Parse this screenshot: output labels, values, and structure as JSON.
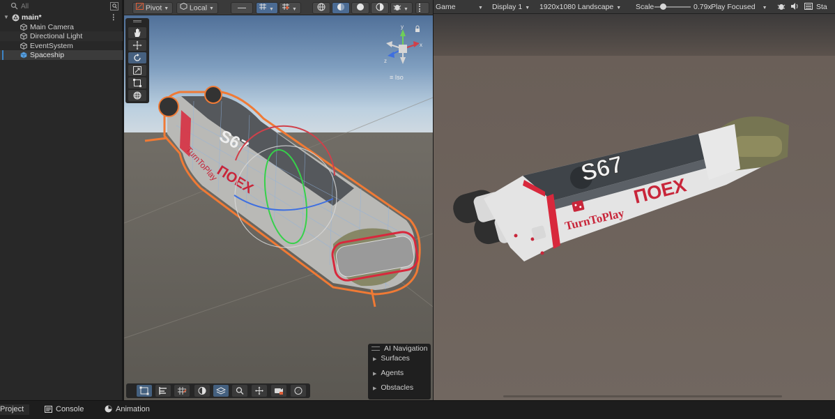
{
  "hierarchy": {
    "search_placeholder": "All",
    "scene_name": "main*",
    "items": [
      {
        "label": "Main Camera"
      },
      {
        "label": "Directional Light"
      },
      {
        "label": "EventSystem"
      },
      {
        "label": "Spaceship"
      }
    ]
  },
  "scene_toolbar": {
    "pivot_label": "Pivot",
    "space_label": "Local"
  },
  "scene": {
    "projection_label": "Iso",
    "gizmo_axes": {
      "y": "y",
      "x": "x",
      "z": "z"
    },
    "ship_number": "S67",
    "ship_brand": "TurnToPlay",
    "ship_text": "ПОЕХ"
  },
  "ai_navigation": {
    "title": "AI Navigation",
    "items": [
      {
        "label": "Surfaces"
      },
      {
        "label": "Agents"
      },
      {
        "label": "Obstacles"
      }
    ]
  },
  "game_toolbar": {
    "tab_label": "Game",
    "display_label": "Display 1",
    "resolution_label": "1920x1080 Landscape",
    "scale_label": "Scale",
    "scale_value": "0.79x",
    "play_mode_label": "Play Focused",
    "stats_label": "Sta"
  },
  "bottom_tabs": [
    {
      "label": "Project"
    },
    {
      "label": "Console"
    },
    {
      "label": "Animation"
    }
  ],
  "colors": {
    "selection": "#3d84c6",
    "outline": "#f07a35",
    "ship_red": "#d8283c",
    "active_tool": "#46607f"
  }
}
